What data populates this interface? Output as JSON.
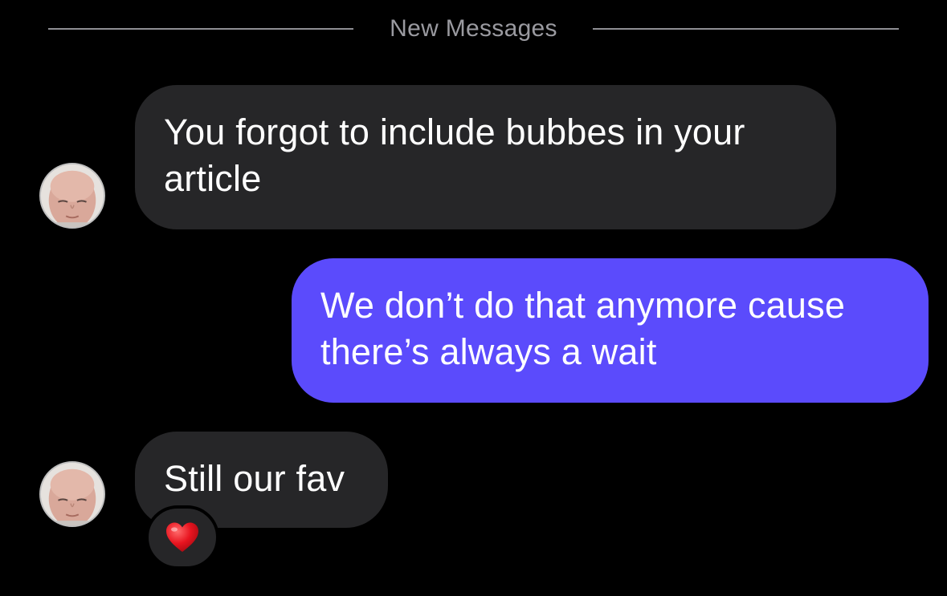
{
  "divider": {
    "label": "New Messages"
  },
  "messages": [
    {
      "direction": "received",
      "text": "You forgot to include bubbes in your article",
      "line1": "You forgot to include bubbes in your",
      "line2": "article"
    },
    {
      "direction": "sent",
      "text": "We don’t do that anymore cause there’s always a wait",
      "line1": "We don’t do that anymore cause",
      "line2": "there’s always a wait"
    },
    {
      "direction": "received",
      "text": "Still our fav",
      "reaction": "heart-icon"
    }
  ],
  "colors": {
    "background": "#000000",
    "received_bubble": "#262628",
    "sent_bubble": "#5b4bfc",
    "divider": "#8e8e93",
    "heart": "#e8141f"
  }
}
